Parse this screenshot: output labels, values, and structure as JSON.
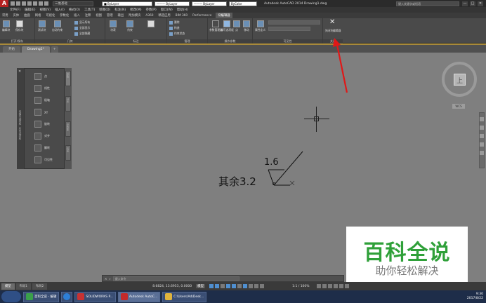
{
  "titlebar": {
    "logo": "A",
    "workspace": "三维基础",
    "layer_values": [
      "■ ByLayer",
      "——— ByLayer",
      "——— ByLayer",
      "ByColor"
    ],
    "title": "Autodesk AutoCAD 2014  Drawing1.dwg",
    "search_placeholder": "键入关键字或短语",
    "win_buttons": [
      "—",
      "□",
      "✕"
    ]
  },
  "menubar": [
    "文件(F)",
    "编辑(E)",
    "视图(V)",
    "插入(I)",
    "格式(O)",
    "工具(T)",
    "绘图(D)",
    "标注(N)",
    "修改(M)",
    "参数(P)",
    "窗口(W)",
    "帮助(H)"
  ],
  "ribbon_tabs": [
    "常用",
    "实体",
    "曲面",
    "网格",
    "可视化",
    "参数化",
    "插入",
    "注释",
    "视图",
    "管理",
    "输出",
    "附加模块",
    "A360",
    "精选应用",
    "BIM 360",
    "Performance",
    "块编辑器"
  ],
  "ribbon_active_tab": "块编辑器",
  "ribbon": {
    "open_save": {
      "title": "打开/保存",
      "buttons": [
        "编辑块",
        "保存块"
      ]
    },
    "geometry": {
      "title": "几何",
      "buttons": [
        "测试块",
        "自动约束"
      ]
    },
    "geo_list": [
      "显示所有",
      "全部显示",
      "全部隐藏"
    ],
    "dimension": {
      "title": "标注",
      "buttons": [
        "块表",
        "约束"
      ]
    },
    "manage": {
      "title": "管理",
      "buttons": [
        "删除",
        "构造",
        "约束状态"
      ]
    },
    "action_params": {
      "title": "操作参数",
      "buttons": [
        "参数管理器",
        "编写选项板",
        "点",
        "移动"
      ]
    },
    "visibility": {
      "title": "可见性",
      "buttons": [
        "属性定义"
      ]
    },
    "close": {
      "title": "关闭",
      "button": "关闭块编辑器"
    }
  },
  "file_tabs": [
    "开始",
    "Drawing1*",
    "+"
  ],
  "palette": {
    "items": [
      "点",
      "线性",
      "极轴",
      "XY",
      "旋转",
      "对齐",
      "翻转",
      "可见性"
    ],
    "side_tabs": [
      "参数",
      "动作",
      "参数集",
      "约束"
    ],
    "strip_text": [
      "块编写选项板 - 所有选项板"
    ]
  },
  "annotation": {
    "value": "1.6",
    "rest": "其余3.2"
  },
  "viewcube": {
    "face": "上",
    "wcs": "WCS"
  },
  "watermark": {
    "main": "百科全说",
    "sub": "助你轻松解决"
  },
  "cmdline": {
    "prefix": "✕",
    "prompt": "键入命令"
  },
  "layout_tabs": [
    "模型",
    "布局1",
    "布局2"
  ],
  "status": {
    "coords": "8.6824, 13.6953, 0.0000",
    "model_label": "模型",
    "zoom": "1:1 / 100%"
  },
  "taskbar": {
    "apps": [
      "百科全说 - 编辑",
      "SOLIDWORKS P...",
      "Autodesk AutoC...",
      "C:\\Users\\Ad\\Desk..."
    ],
    "time": "9:30",
    "date": "2017/8/22"
  },
  "colors": {
    "accent": "#a88a3a",
    "watermark_green": "#2fa039",
    "arrow_red": "#e01818"
  }
}
